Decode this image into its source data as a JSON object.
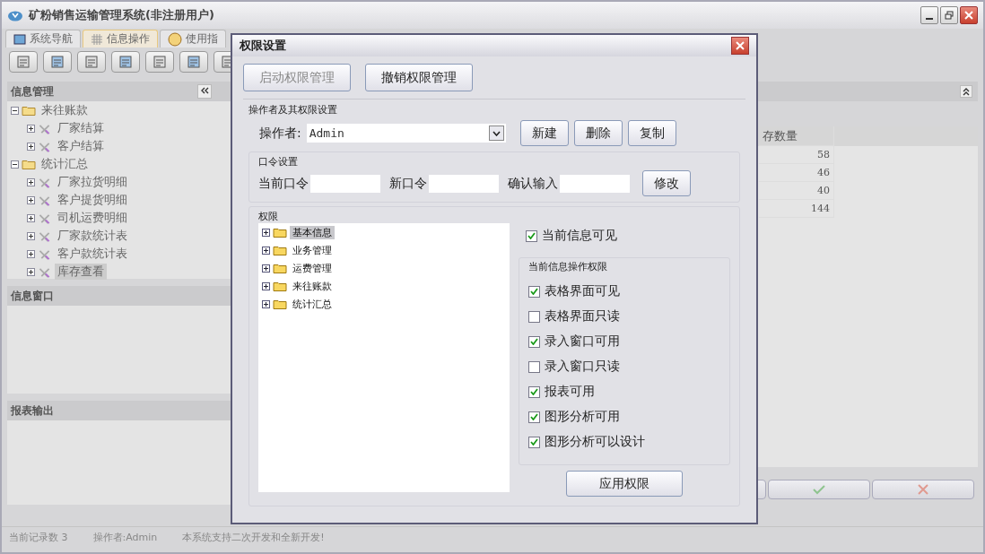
{
  "window": {
    "title": "矿粉销售运输管理系统(非注册用户)"
  },
  "tabs": [
    {
      "label": "系统导航",
      "selected": false
    },
    {
      "label": "信息操作",
      "selected": true
    },
    {
      "label": "使用指",
      "selected": false
    }
  ],
  "sidebar": {
    "panels": [
      {
        "title": "信息管理",
        "tree": [
          {
            "label": "来往账款",
            "expanded": true,
            "selected": false,
            "children": [
              {
                "label": "厂家结算",
                "expanded": false,
                "selected": false
              },
              {
                "label": "客户结算",
                "expanded": false,
                "selected": false
              }
            ]
          },
          {
            "label": "统计汇总",
            "expanded": true,
            "selected": false,
            "children": [
              {
                "label": "厂家拉货明细",
                "expanded": false,
                "selected": false
              },
              {
                "label": "客户提货明细",
                "expanded": false,
                "selected": false
              },
              {
                "label": "司机运费明细",
                "expanded": false,
                "selected": false
              },
              {
                "label": "厂家款统计表",
                "expanded": false,
                "selected": false
              },
              {
                "label": "客户款统计表",
                "expanded": false,
                "selected": false
              },
              {
                "label": "库存查看",
                "expanded": false,
                "selected": true
              }
            ]
          }
        ]
      },
      {
        "title": "信息窗口"
      },
      {
        "title": "报表输出"
      }
    ]
  },
  "table": {
    "columns": [
      "存数量"
    ],
    "rows": [
      [
        "58"
      ],
      [
        "46"
      ],
      [
        "40"
      ],
      [
        "144"
      ]
    ]
  },
  "status_bar": [
    "当前记录数 3",
    "操作者:Admin",
    "本系统支持二次开发和全新开发!"
  ],
  "dialog": {
    "title": "权限设置",
    "top_buttons": [
      {
        "label": "启动权限管理",
        "disabled": true
      },
      {
        "label": "撤销权限管理",
        "disabled": false
      }
    ],
    "operator_section": {
      "title": "操作者及其权限设置",
      "label": "操作者:",
      "value": "Admin",
      "buttons": [
        "新建",
        "删除",
        "复制"
      ]
    },
    "password_section": {
      "title": "口令设置",
      "fields": [
        {
          "label": "当前口令"
        },
        {
          "label": "新口令"
        },
        {
          "label": "确认输入"
        }
      ],
      "button": "修改"
    },
    "permissions": {
      "title": "权限",
      "tree": [
        {
          "label": "基本信息",
          "expanded": false,
          "selected": true
        },
        {
          "label": "业务管理",
          "expanded": false,
          "selected": false
        },
        {
          "label": "运费管理",
          "expanded": false,
          "selected": false
        },
        {
          "label": "来往账款",
          "expanded": false,
          "selected": false
        },
        {
          "label": "统计汇总",
          "expanded": false,
          "selected": false
        }
      ],
      "visible_checkbox": {
        "label": "当前信息可见",
        "checked": true
      },
      "operations": {
        "title": "当前信息操作权限",
        "items": [
          {
            "label": "表格界面可见",
            "checked": true
          },
          {
            "label": "表格界面只读",
            "checked": false
          },
          {
            "label": "录入窗口可用",
            "checked": true
          },
          {
            "label": "录入窗口只读",
            "checked": false
          },
          {
            "label": "报表可用",
            "checked": true
          },
          {
            "label": "图形分析可用",
            "checked": true
          },
          {
            "label": "图形分析可以设计",
            "checked": true
          }
        ]
      },
      "apply_button": "应用权限"
    }
  }
}
